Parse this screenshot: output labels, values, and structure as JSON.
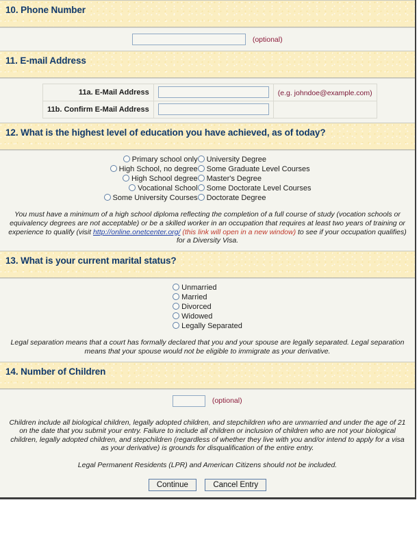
{
  "sections": {
    "phone": {
      "heading": "10. Phone Number",
      "optional_note": "(optional)"
    },
    "email": {
      "heading": "11. E-mail Address",
      "row_a_label": "11a. E-Mail Address",
      "row_b_label": "11b. Confirm E-Mail Address",
      "example_note": "(e.g. johndoe@example.com)"
    },
    "education": {
      "heading": "12. What is the highest level of education you have achieved, as of today?",
      "options_left": [
        "Primary school only",
        "High School, no degree",
        "High School degree",
        "Vocational School",
        "Some University Courses"
      ],
      "options_right": [
        "University Degree",
        "Some Graduate Level Courses",
        "Master's Degree",
        "Some Doctorate Level Courses",
        "Doctorate Degree"
      ],
      "help_part1": "You must have a minimum of a high school diploma reflecting the completion of a full course of study (vocation schools or equivalency degrees are not acceptable) or be a skilled worker in an occupation that requires at least two years of training or experience to qualify (visit ",
      "help_link": "http://online.onetcenter.org/",
      "help_newwindow": " (this link will open in a new window)",
      "help_part2": " to see if your occupation qualifies) for a Diversity Visa."
    },
    "marital": {
      "heading": "13. What is your current marital status?",
      "options": [
        "Unmarried",
        "Married",
        "Divorced",
        "Widowed",
        "Legally Separated"
      ],
      "help": "Legal separation means that a court has formally declared that you and your spouse are legally separated. Legal separation means that your spouse would not be eligible to immigrate as your derivative."
    },
    "children": {
      "heading": "14. Number of Children",
      "optional_note": "(optional)",
      "help_main": "Children include all biological children, legally adopted children, and stepchildren who are unmarried and under the age of 21 on the date that you submit your entry. Failure to include all children or inclusion of children who are not your biological children, legally adopted children, and stepchildren (regardless of whether they live with you and/or intend to apply for a visa as your derivative) is grounds for disqualification of the entire entry.",
      "help_secondary": "Legal Permanent Residents (LPR) and American Citizens should not be included."
    }
  },
  "buttons": {
    "continue": "Continue",
    "cancel": "Cancel Entry"
  },
  "values": {
    "phone": "",
    "email": "",
    "email_confirm": "",
    "children_count": ""
  },
  "colors": {
    "band": "#fbeec1",
    "heading_text": "#123a6b",
    "hint_text": "#8b1a3a",
    "link": "#1f3fa8",
    "newwindow_note": "#c0392b",
    "input_border": "#8fa9c4"
  }
}
